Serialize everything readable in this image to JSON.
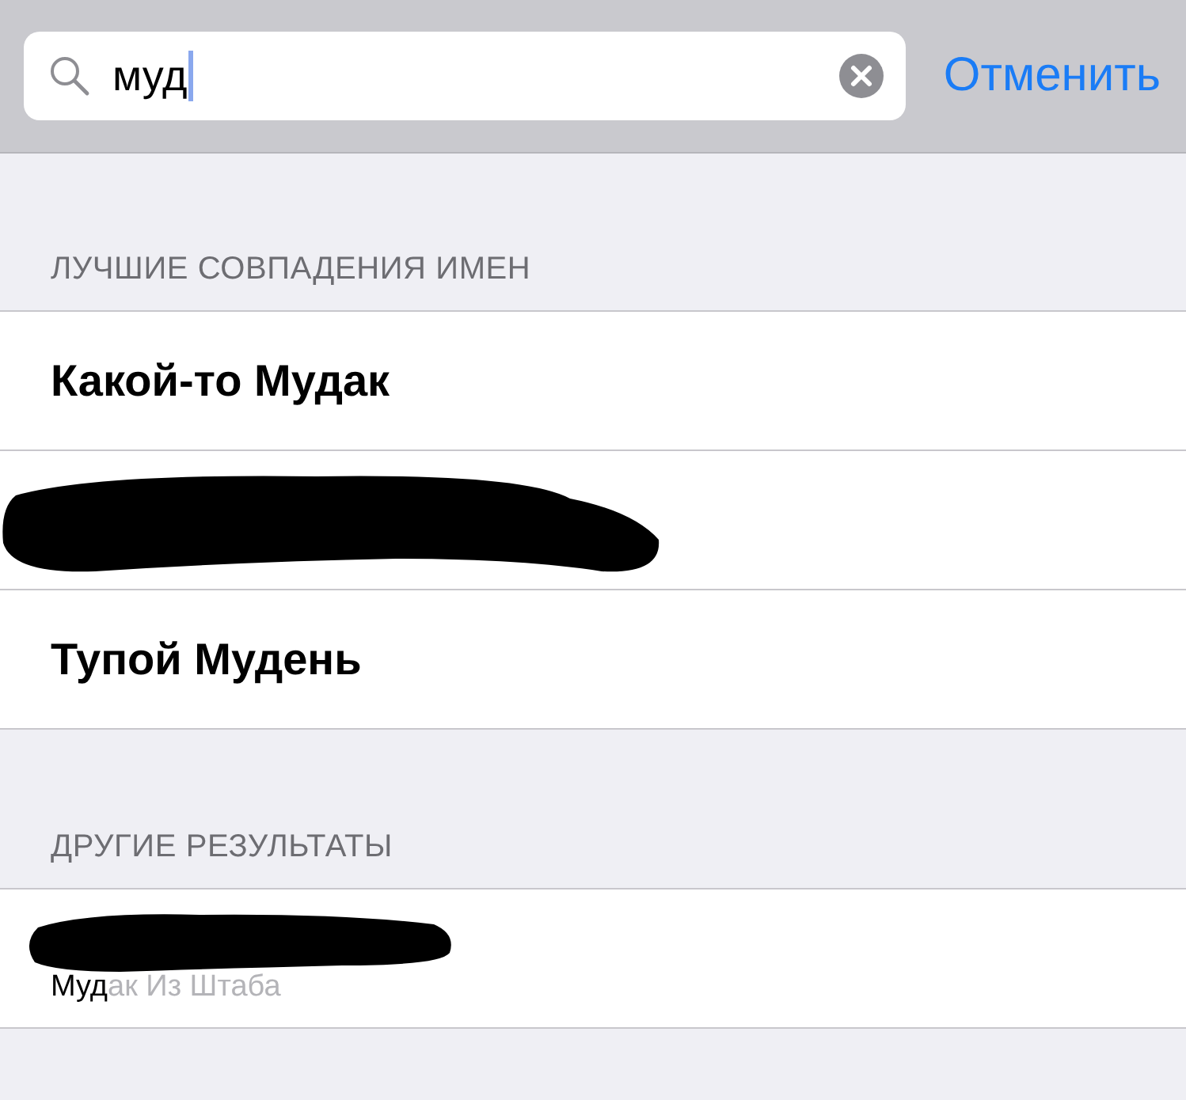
{
  "search": {
    "value": "муд",
    "cancel": "Отменить"
  },
  "sections": [
    {
      "title": "ЛУЧШИЕ СОВПАДЕНИЯ ИМЕН",
      "rows": [
        {
          "kind": "name",
          "name": "Какой-то Мудак"
        },
        {
          "kind": "redacted"
        },
        {
          "kind": "name",
          "name": "Тупой Мудень"
        }
      ]
    },
    {
      "title": "ДРУГИЕ РЕЗУЛЬТАТЫ",
      "rows": [
        {
          "kind": "redacted-detail",
          "match": "Муд",
          "rest": "ак Из Штаба"
        }
      ]
    }
  ]
}
